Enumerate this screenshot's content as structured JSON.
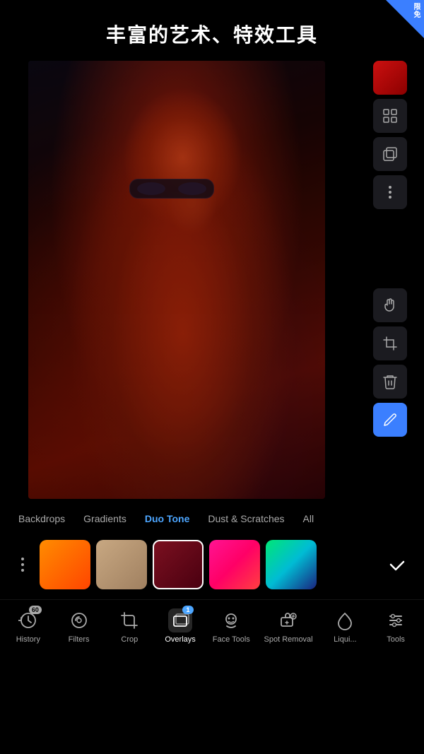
{
  "header": {
    "title": "丰富的艺术、特效工具"
  },
  "corner_badge": {
    "text": "限免"
  },
  "categories": [
    {
      "id": "backdrops",
      "label": "Backdrops",
      "active": false
    },
    {
      "id": "gradients",
      "label": "Gradients",
      "active": false
    },
    {
      "id": "duo-tone",
      "label": "Duo Tone",
      "active": true
    },
    {
      "id": "dust-scratches",
      "label": "Dust & Scratches",
      "active": false
    },
    {
      "id": "all",
      "label": "All",
      "active": false
    }
  ],
  "swatches": [
    {
      "id": "orange",
      "label": "Orange Gradient",
      "selected": false
    },
    {
      "id": "tan",
      "label": "Tan Gradient",
      "selected": false
    },
    {
      "id": "red-dark",
      "label": "Red Dark Gradient",
      "selected": true
    },
    {
      "id": "pink",
      "label": "Pink Gradient",
      "selected": false
    },
    {
      "id": "green",
      "label": "Green Gradient",
      "selected": false
    }
  ],
  "toolbar_right": {
    "color_swatch_label": "Color Swatch",
    "pattern_label": "Pattern Tool",
    "duplicate_label": "Duplicate",
    "more_label": "More Options",
    "hand_label": "Hand Tool",
    "crop_resize_label": "Crop/Resize",
    "delete_label": "Delete",
    "edit_label": "Edit/Pen Tool"
  },
  "bottom_tools": [
    {
      "id": "history",
      "label": "History",
      "badge": "60",
      "active": false
    },
    {
      "id": "filters",
      "label": "Filters",
      "badge": null,
      "active": false
    },
    {
      "id": "crop",
      "label": "Crop",
      "badge": null,
      "active": false
    },
    {
      "id": "overlays",
      "label": "Overlays",
      "badge": "1",
      "active": true
    },
    {
      "id": "face-tools",
      "label": "Face Tools",
      "badge": null,
      "active": false
    },
    {
      "id": "spot-removal",
      "label": "Spot Removal",
      "badge": null,
      "active": false
    },
    {
      "id": "liquify",
      "label": "Liqui...",
      "badge": null,
      "active": false
    },
    {
      "id": "tools",
      "label": "Tools",
      "badge": null,
      "active": false
    }
  ],
  "check_label": "✓",
  "colors": {
    "active_blue": "#3b7fff",
    "active_tab": "#4da6ff"
  }
}
